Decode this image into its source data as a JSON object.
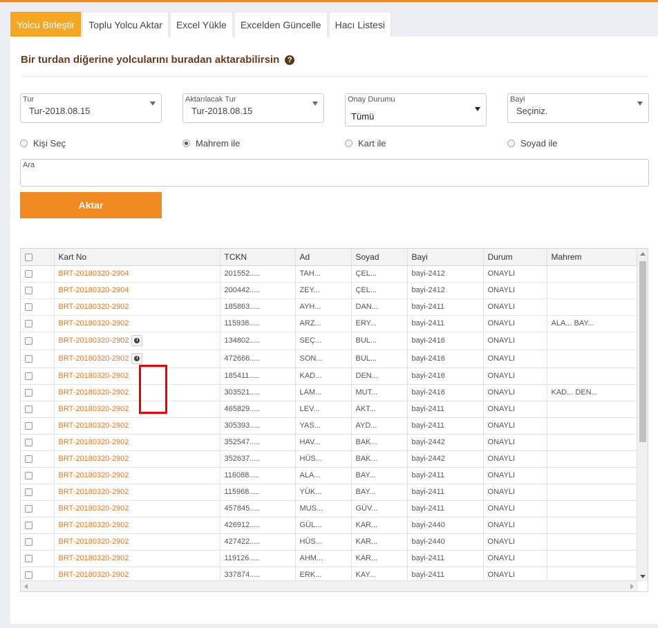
{
  "colors": {
    "accent": "#f0891f",
    "active_tab": "#f5a623",
    "link": "#e87722",
    "heading": "#6b3b1e"
  },
  "tabs": [
    "Yolcu Birleştir",
    "Toplu Yolcu Aktar",
    "Excel Yükle",
    "Excelden Güncelle",
    "Hacı Listesi"
  ],
  "heading": "Bir turdan diğerine yolcularını buradan aktarabilirsin",
  "help_icon": "question-circle-icon",
  "filters": {
    "tur": {
      "label": "Tur",
      "value": "Tur-2018.08.15"
    },
    "aktarilacak_tur": {
      "label": "Aktarılacak Tur",
      "value": "Tur-2018.08.15"
    },
    "onay_durumu": {
      "label": "Onay Durumu",
      "value": "Tümü"
    },
    "bayi": {
      "label": "Bayi",
      "value": "Seçiniz."
    }
  },
  "radios": [
    {
      "label": "Kişi Seç",
      "checked": false
    },
    {
      "label": "Mahrem ile",
      "checked": true
    },
    {
      "label": "Kart ile",
      "checked": false
    },
    {
      "label": "Soyad ile",
      "checked": false
    }
  ],
  "search": {
    "label": "Ara"
  },
  "aktar_button": "Aktar",
  "table": {
    "columns": [
      "Kart No",
      "TCKN",
      "Ad",
      "Soyad",
      "Bayi",
      "Durum",
      "Mahrem"
    ],
    "rows": [
      [
        "BRT-20180320-2904",
        "201552.....",
        "TAH...",
        "ÇEL...",
        "bayi-2412",
        "ONAYLI",
        ""
      ],
      [
        "BRT-20180320-2904",
        "200442.....",
        "ZEY...",
        "ÇEL...",
        "bayi-2412",
        "ONAYLI",
        ""
      ],
      [
        "BRT-20180320-2902",
        "185863.....",
        "AYH...",
        "DAN...",
        "bayi-2411",
        "ONAYLI",
        ""
      ],
      [
        "BRT-20180320-2902",
        "115938.....",
        "ARZ...",
        "ERY...",
        "bayi-2411",
        "ONAYLI",
        "ALA... BAY..."
      ],
      [
        "BRT-20180320-2902",
        "134802.....",
        "SEÇ...",
        "BUL...",
        "bayi-2416",
        "ONAYLI",
        ""
      ],
      [
        "BRT-20180320-2902",
        "472666.....",
        "SON...",
        "BUL...",
        "bayi-2416",
        "ONAYLI",
        ""
      ],
      [
        "BRT-20180320-2902",
        "185411.....",
        "KAD...",
        "DEN...",
        "bayi-2416",
        "ONAYLI",
        ""
      ],
      [
        "BRT-20180320-2902",
        "303521.....",
        "LAM...",
        "MUT...",
        "bayi-2416",
        "ONAYLI",
        "KAD... DEN..."
      ],
      [
        "BRT-20180320-2902",
        "465829.....",
        "LEV...",
        "AKT...",
        "bayi-2411",
        "ONAYLI",
        ""
      ],
      [
        "BRT-20180320-2902",
        "305393.....",
        "YAS...",
        "AYD...",
        "bayi-2411",
        "ONAYLI",
        ""
      ],
      [
        "BRT-20180320-2902",
        "352547.....",
        "HAV...",
        "BAK...",
        "bayi-2442",
        "ONAYLI",
        ""
      ],
      [
        "BRT-20180320-2902",
        "352637.....",
        "HÜS...",
        "BAK...",
        "bayi-2442",
        "ONAYLI",
        ""
      ],
      [
        "BRT-20180320-2902",
        "116088.....",
        "ALA...",
        "BAY...",
        "bayi-2411",
        "ONAYLI",
        ""
      ],
      [
        "BRT-20180320-2902",
        "115968.....",
        "YÜK...",
        "BAY...",
        "bayi-2411",
        "ONAYLI",
        ""
      ],
      [
        "BRT-20180320-2902",
        "457845.....",
        "MUS...",
        "GÜV...",
        "bayi-2411",
        "ONAYLI",
        ""
      ],
      [
        "BRT-20180320-2902",
        "426912.....",
        "GÜL...",
        "KAR...",
        "bayi-2440",
        "ONAYLI",
        ""
      ],
      [
        "BRT-20180320-2902",
        "427422.....",
        "HÜS...",
        "KAR...",
        "bayi-2440",
        "ONAYLI",
        ""
      ],
      [
        "BRT-20180320-2902",
        "119126.....",
        "AHM...",
        "KAR...",
        "bayi-2411",
        "ONAYLI",
        ""
      ],
      [
        "BRT-20180320-2902",
        "337874.....",
        "ERK...",
        "KAY...",
        "bayi-2411",
        "ONAYLI",
        ""
      ]
    ],
    "info_rows": [
      4,
      5
    ]
  }
}
